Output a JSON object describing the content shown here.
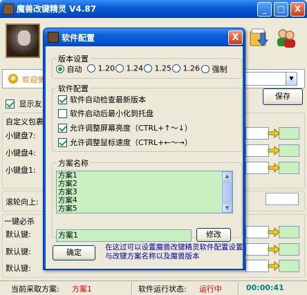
{
  "main": {
    "title": "魔兽改键精灵 V4.87",
    "title_buttons": [
      "_",
      "□",
      "X"
    ],
    "welcome_text": "欢迎使",
    "show_friend_label": "显示友",
    "save_button": "保存",
    "custom_pkg_label": "自定义包裹",
    "numpad_labels": [
      "小键盘7:",
      "小键盘4:",
      "小键盘1:"
    ],
    "wheel_up_label": "滚轮向上:",
    "one_key_label": "一键必杀",
    "default_key_labels": [
      "默认键:",
      "默认键:",
      "默认键:"
    ],
    "status": {
      "current_scheme_label": "当前采取方案:",
      "current_scheme_value": "方案1",
      "run_state_label": "软件运行状态:",
      "run_state_value": "运行中",
      "timer": "00:00:41"
    }
  },
  "dialog": {
    "title": "软件配置",
    "close_label": "X",
    "version_group": {
      "legend": "版本设置",
      "options": [
        "自动",
        "1.20",
        "1.24",
        "1.25",
        "1.26",
        "强制"
      ],
      "selected": "自动"
    },
    "config_group": {
      "legend": "软件配置",
      "items": [
        {
          "label": "软件自动检查最新版本",
          "checked": true
        },
        {
          "label": "软件启动后最小化到托盘",
          "checked": false
        },
        {
          "label": "允许调整屏幕亮度（CTRL+↑～↓）",
          "checked": true
        },
        {
          "label": "允许调整鼠标速度（CTRL+←～→）",
          "checked": true
        }
      ]
    },
    "scheme_group": {
      "legend": "方案名称",
      "list": [
        "方案1",
        "方案2",
        "方案3",
        "方案4",
        "方案5"
      ],
      "name_value": "方案1",
      "modify_button": "修改"
    },
    "ok_button": "确定",
    "note": "在这过可以设置魔兽改键精灵软件配置设置与改键方案名称以及魔兽版本"
  }
}
